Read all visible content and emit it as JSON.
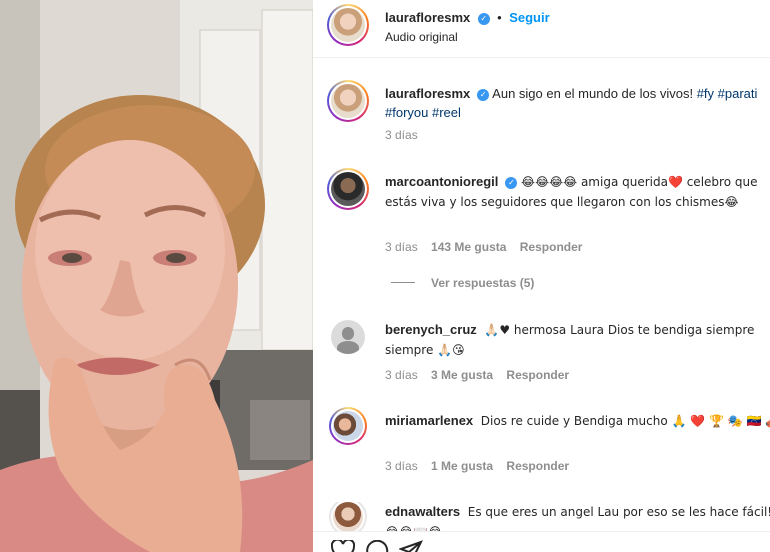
{
  "post": {
    "author": "laurafloresmx",
    "separator": "•",
    "follow_label": "Seguir",
    "audio_label": "Audio original",
    "verified_glyph": "✓"
  },
  "caption": {
    "username": "laurafloresmx",
    "text": "Aun sigo en el mundo de los vivos!",
    "hashtags": "#fy #parati #foryou #reel",
    "time": "3 días"
  },
  "comments": [
    {
      "username": "marcoantonioregil",
      "text": "😂😂😂😂 amiga querida❤️ celebro que estás viva y los seguidores que llegaron con los chismes😂",
      "time": "3 días",
      "likes": "143 Me gusta",
      "reply": "Responder",
      "view_replies": "Ver respuestas (5)"
    },
    {
      "username": "berenych_cruz",
      "text": "🙏🏻♥ hermosa Laura Dios te bendiga siempre siempre 🙏🏻😘",
      "time": "3 días",
      "likes": "3 Me gusta",
      "reply": "Responder"
    },
    {
      "username": "miriamarlenex",
      "text": "Dios re cuide y Bendiga mucho 🙏 ❤️ 🏆 🎭 🇻🇪 🎻",
      "time": "3 días",
      "likes": "1 Me gusta",
      "reply": "Responder"
    },
    {
      "username": "ednawalters",
      "text": "Es que eres un angel Lau por eso se les hace fácil! 😂😂📖😂"
    }
  ],
  "icons": [
    "heart-icon",
    "comment-icon",
    "share-icon"
  ],
  "colors": {
    "link": "#0095f6",
    "verified": "#3897f0",
    "muted": "#8e8e8e",
    "hashtag": "#00376b"
  }
}
